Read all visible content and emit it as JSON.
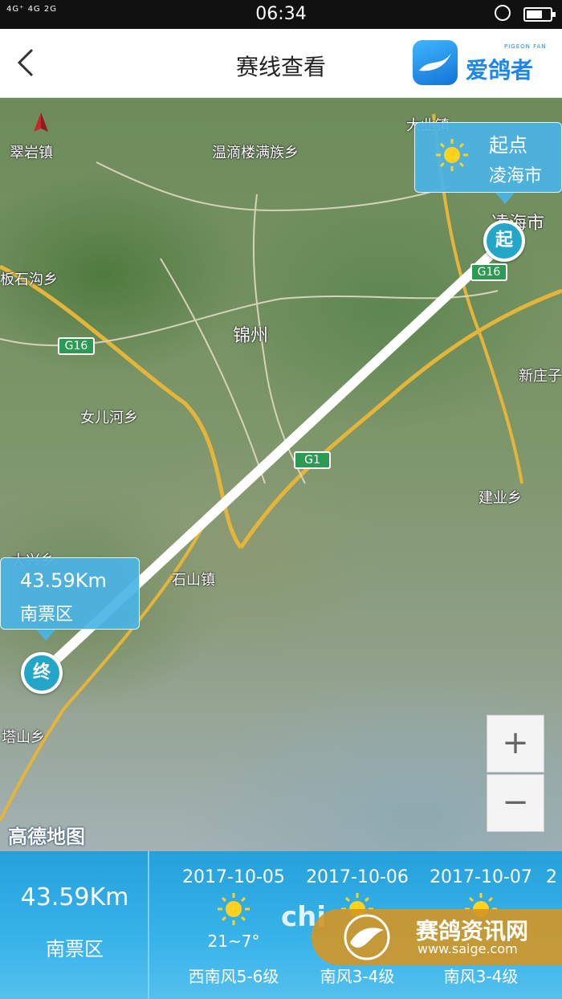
{
  "status_bar": {
    "signal": "4G⁺ 4G  2G",
    "time": "06:34",
    "alarm_icon": "alarm-icon",
    "battery_icon": "battery-icon"
  },
  "header": {
    "title": "赛线查看",
    "back_icon": "back-arrow-icon",
    "logo_text": "爱鸽者",
    "logo_sub": "PIGEON FAN"
  },
  "map": {
    "places": {
      "cuiyanzhen": "翠岩镇",
      "wendilou": "温滴楼满族乡",
      "dayezhen": "大业镇",
      "banshigou": "板石沟乡",
      "jinzhou": "锦州",
      "lingh aishi": "凌海市",
      "xinzhuangzi": "新庄子",
      "nvrhe": "女儿河乡",
      "jianye": "建业乡",
      "daxing": "大兴乡",
      "shishan": "石山镇",
      "tashan": "塔山乡"
    },
    "roads": {
      "g16_a": "G16",
      "g16_b": "G16",
      "g1": "G1"
    },
    "start_callout": {
      "label": "起点",
      "city": "凌海市",
      "weather_icon": "sun-icon"
    },
    "end_callout": {
      "distance": "43.59Km",
      "city": "南票区"
    },
    "start_pin": "起",
    "end_pin": "终",
    "zoom_in": "+",
    "zoom_out": "−",
    "provider": "高德地图",
    "compass_icon": "north-compass-icon"
  },
  "summary": {
    "distance": "43.59Km",
    "area": "南票区"
  },
  "forecast": [
    {
      "date": "2017-10-05",
      "temp": "21~7°",
      "wind": "西南风5-6级",
      "icon": "sun-icon"
    },
    {
      "date": "2017-10-06",
      "temp": "",
      "wind": "南风3-4级",
      "icon": "sun-icon"
    },
    {
      "date": "2017-10-07",
      "temp": "",
      "wind": "南风3-4级",
      "icon": "sun-icon"
    },
    {
      "date": "2",
      "temp": "",
      "wind": "",
      "icon": ""
    }
  ],
  "watermark": {
    "title": "赛鸽资讯网",
    "url": "www.saige.com",
    "overlay_text": "chi"
  }
}
